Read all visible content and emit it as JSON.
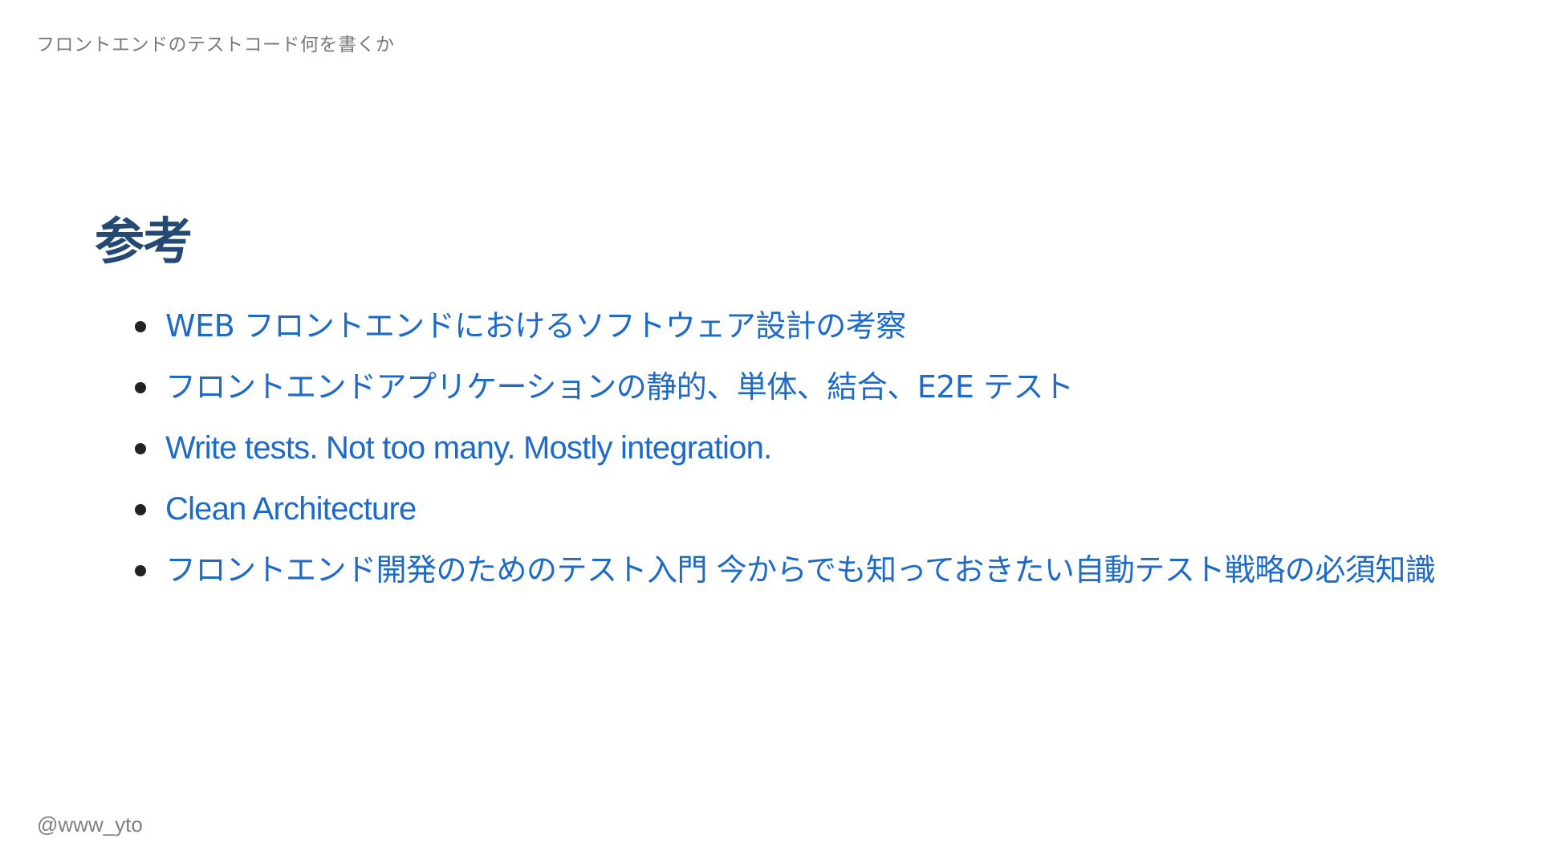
{
  "slide": {
    "header": "フロントエンドのテストコード何を書くか",
    "footer": "@www_yto",
    "title": "参考",
    "references": [
      {
        "label": "WEB フロントエンドにおけるソフトウェア設計の考察"
      },
      {
        "label": "フロントエンドアプリケーションの静的、単体、結合、E2E テスト"
      },
      {
        "label": "Write tests. Not too many. Mostly integration."
      },
      {
        "label": "Clean Architecture"
      },
      {
        "label": "フロントエンド開発のためのテスト入門 今からでも知っておきたい自動テスト戦略の必須知識"
      }
    ]
  },
  "colors": {
    "title": "#244a74",
    "link": "#1d6ac8",
    "header_text": "#7a7a7a",
    "bullet": "#222222",
    "background": "#ffffff"
  }
}
